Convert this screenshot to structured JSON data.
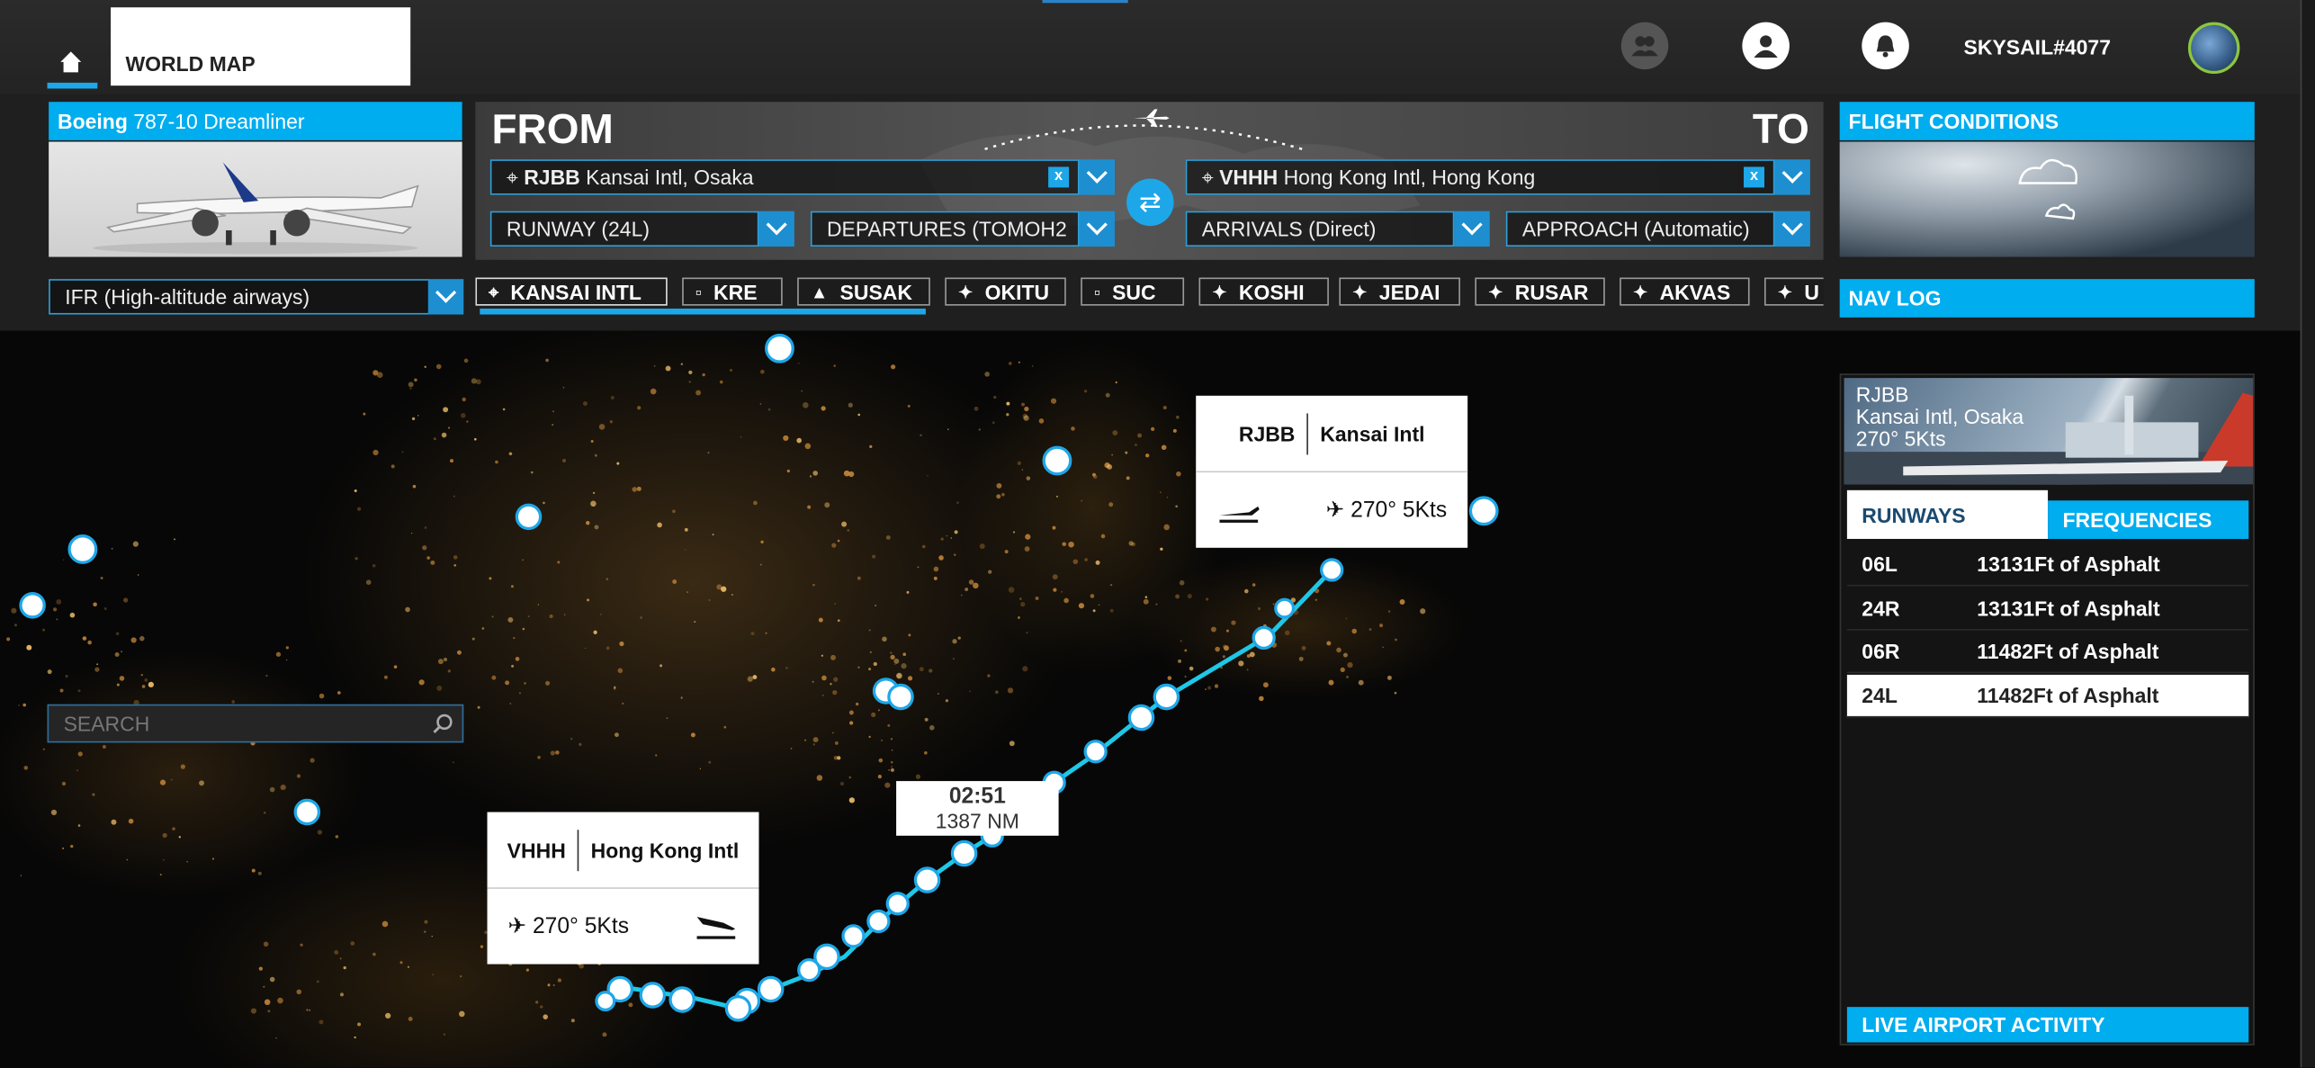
{
  "topbar": {
    "world_map_tab": "WORLD MAP",
    "username": "SKYSAIL#4077"
  },
  "aircraft": {
    "make": "Boeing",
    "model": "787-10 Dreamliner"
  },
  "from": {
    "label": "FROM",
    "icao": "RJBB",
    "name": "Kansai Intl, Osaka",
    "runway": "RUNWAY (24L)",
    "departure": "DEPARTURES (TOMOH2"
  },
  "to": {
    "label": "TO",
    "icao": "VHHH",
    "name": "Hong Kong Intl, Hong Kong",
    "arrival": "ARRIVALS (Direct)",
    "approach": "APPROACH (Automatic)"
  },
  "conditions": {
    "title": "FLIGHT CONDITIONS"
  },
  "route_type": "IFR (High-altitude airways)",
  "navlog": "NAV LOG",
  "waypoints": [
    {
      "label": "KANSAI INTL",
      "symbol": "airport"
    },
    {
      "label": "KRE",
      "symbol": "vor"
    },
    {
      "label": "SUSAK",
      "symbol": "triangle"
    },
    {
      "label": "OKITU",
      "symbol": "star"
    },
    {
      "label": "SUC",
      "symbol": "vor"
    },
    {
      "label": "KOSHI",
      "symbol": "star"
    },
    {
      "label": "JEDAI",
      "symbol": "star"
    },
    {
      "label": "RUSAR",
      "symbol": "star"
    },
    {
      "label": "AKVAS",
      "symbol": "star"
    },
    {
      "label": "U",
      "symbol": "star"
    }
  ],
  "search": {
    "placeholder": "SEARCH"
  },
  "origin_card": {
    "icao": "RJBB",
    "name": "Kansai Intl",
    "wind": "270° 5Kts"
  },
  "dest_card": {
    "icao": "VHHH",
    "name": "Hong Kong Intl",
    "wind": "270° 5Kts"
  },
  "route_info": {
    "time": "02:51",
    "distance": "1387 NM"
  },
  "airport_panel": {
    "icao": "RJBB",
    "name": "Kansai Intl, Osaka",
    "wind": "270° 5Kts",
    "tab_runways": "RUNWAYS",
    "tab_frequencies": "FREQUENCIES",
    "runways": [
      {
        "id": "06L",
        "desc": "13131Ft of Asphalt"
      },
      {
        "id": "24R",
        "desc": "13131Ft of Asphalt"
      },
      {
        "id": "06R",
        "desc": "11482Ft of Asphalt"
      },
      {
        "id": "24L",
        "desc": "11482Ft of Asphalt",
        "selected": true
      }
    ],
    "live": "LIVE AIRPORT ACTIVITY"
  },
  "colors": {
    "accent": "#00adef",
    "route": "#1ec8e6"
  }
}
